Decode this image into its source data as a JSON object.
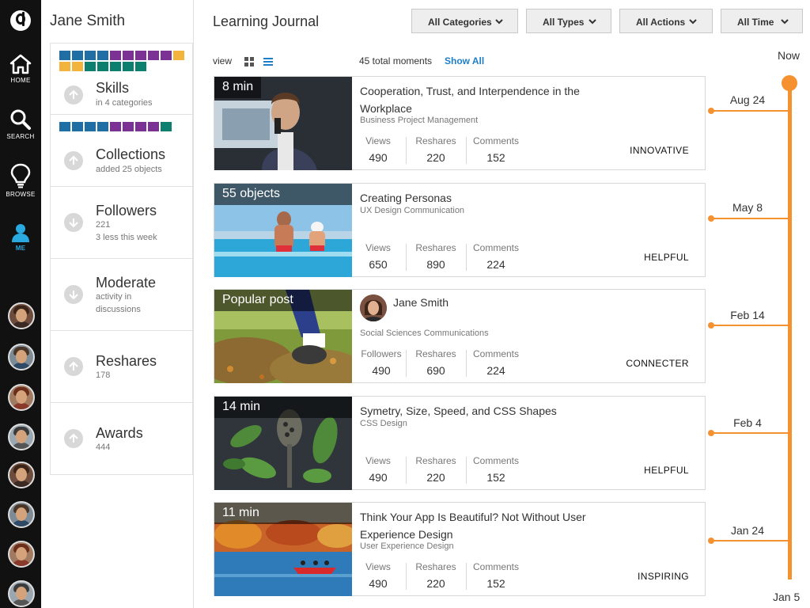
{
  "nav": {
    "items": [
      {
        "label": "HOME",
        "icon": "home-icon"
      },
      {
        "label": "SEARCH",
        "icon": "search-icon"
      },
      {
        "label": "BROWSE",
        "icon": "lightbulb-icon"
      },
      {
        "label": "ME",
        "icon": "person-icon"
      }
    ],
    "active_color": "#29a9e0"
  },
  "profile": {
    "name": "Jane Smith",
    "stats": [
      {
        "title": "Skills",
        "sub": "in 4 categories",
        "arrow": "up"
      },
      {
        "title": "Collections",
        "sub": "added 25 objects",
        "arrow": "up"
      },
      {
        "title": "Followers",
        "sub": "221",
        "sub2": "3 less this week",
        "arrow": "down"
      },
      {
        "title": "Moderate",
        "sub": "activity in",
        "sub2": "discussions",
        "arrow": "down"
      },
      {
        "title": "Reshares",
        "sub": "178",
        "arrow": "up"
      },
      {
        "title": "Awards",
        "sub": "444",
        "arrow": "up"
      }
    ],
    "square_colors": {
      "blue": "#1f6fa5",
      "purple": "#7b3294",
      "teal": "#0d7f6f",
      "yellow": "#f2b43c"
    }
  },
  "main": {
    "title": "Learning Journal",
    "filters": [
      "All Categories",
      "All Types",
      "All Actions",
      "All Time"
    ],
    "view_label": "view",
    "total": "45 total moments",
    "show_all": "Show All",
    "cards": [
      {
        "badge": "8 min",
        "title_line1": "Cooperation, Trust, and Interpendence in the",
        "title_line2": "Workplace",
        "sub": "Business Project Management",
        "metrics": [
          {
            "label": "Views",
            "value": "490"
          },
          {
            "label": "Reshares",
            "value": "220"
          },
          {
            "label": "Comments",
            "value": "152"
          }
        ],
        "tag": "INNOVATIVE"
      },
      {
        "badge": "55 objects",
        "title_line1": "Creating Personas",
        "sub": "UX Design Communication",
        "metrics": [
          {
            "label": "Views",
            "value": "650"
          },
          {
            "label": "Reshares",
            "value": "890"
          },
          {
            "label": "Comments",
            "value": "224"
          }
        ],
        "tag": "HELPFUL"
      },
      {
        "badge": "Popular post",
        "author": "Jane Smith",
        "sub": "Social Sciences Communications",
        "metrics": [
          {
            "label": "Followers",
            "value": "490"
          },
          {
            "label": "Reshares",
            "value": "690"
          },
          {
            "label": "Comments",
            "value": "224"
          }
        ],
        "tag": "CONNECTER"
      },
      {
        "badge": "14 min",
        "title_line1": "Symetry, Size, Speed, and CSS Shapes",
        "sub": "CSS Design",
        "metrics": [
          {
            "label": "Views",
            "value": "490"
          },
          {
            "label": "Reshares",
            "value": "220"
          },
          {
            "label": "Comments",
            "value": "152"
          }
        ],
        "tag": "HELPFUL"
      },
      {
        "badge": "11 min",
        "title_line1": "Think Your App Is Beautiful?  Not Without User",
        "title_line2": "Experience Design",
        "sub": "User Experience Design",
        "metrics": [
          {
            "label": "Views",
            "value": "490"
          },
          {
            "label": "Reshares",
            "value": "220"
          },
          {
            "label": "Comments",
            "value": "152"
          }
        ],
        "tag": "INSPIRING"
      }
    ]
  },
  "timeline": {
    "start": "Now",
    "end": "Jan 5",
    "dates": [
      "Aug 24",
      "May 8",
      "Feb 14",
      "Feb 4",
      "Jan 24"
    ],
    "color": "#f5922f"
  }
}
